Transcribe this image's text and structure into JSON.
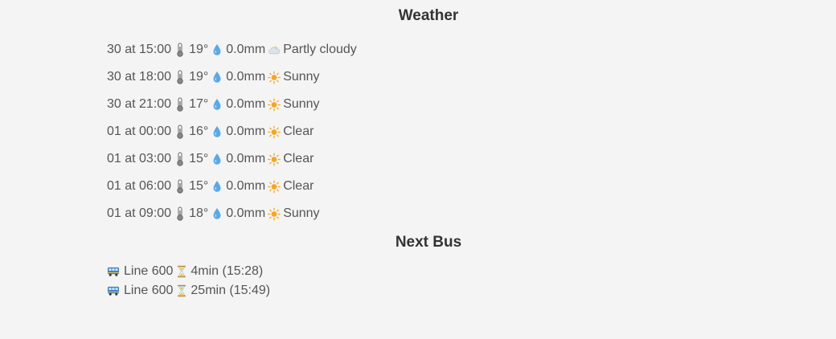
{
  "weather": {
    "title": "Weather",
    "rows": [
      {
        "time": "30 at 15:00",
        "temp": "19°",
        "rain": "0.0mm",
        "condition": "Partly cloudy",
        "icon": "partly-cloudy-icon"
      },
      {
        "time": "30 at 18:00",
        "temp": "19°",
        "rain": "0.0mm",
        "condition": "Sunny",
        "icon": "sun-icon"
      },
      {
        "time": "30 at 21:00",
        "temp": "17°",
        "rain": "0.0mm",
        "condition": "Sunny",
        "icon": "sun-icon"
      },
      {
        "time": "01 at 00:00",
        "temp": "16°",
        "rain": "0.0mm",
        "condition": "Clear",
        "icon": "sun-icon"
      },
      {
        "time": "01 at 03:00",
        "temp": "15°",
        "rain": "0.0mm",
        "condition": "Clear",
        "icon": "sun-icon"
      },
      {
        "time": "01 at 06:00",
        "temp": "15°",
        "rain": "0.0mm",
        "condition": "Clear",
        "icon": "sun-icon"
      },
      {
        "time": "01 at 09:00",
        "temp": "18°",
        "rain": "0.0mm",
        "condition": "Sunny",
        "icon": "sun-icon"
      }
    ]
  },
  "bus": {
    "title": "Next Bus",
    "rows": [
      {
        "line": "Line 600",
        "eta": "4min (15:28)"
      },
      {
        "line": "Line 600",
        "eta": "25min (15:49)"
      }
    ]
  },
  "colors": {
    "background": "#f4f4f4",
    "text": "#555555",
    "title": "#333333",
    "drop": "#5aa9e6",
    "sun": "#f5a623"
  }
}
